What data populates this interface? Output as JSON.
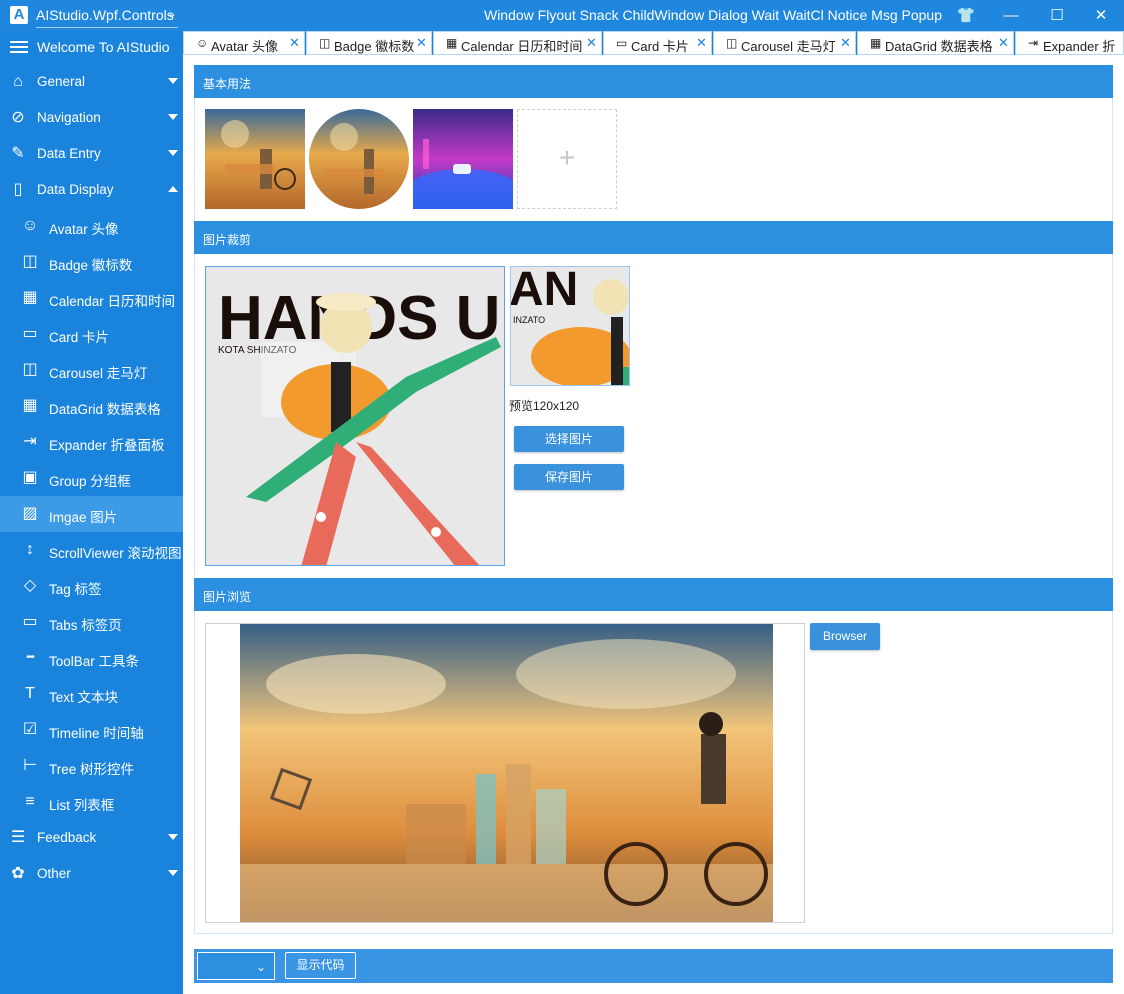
{
  "app": {
    "logo": "A",
    "title": "AIStudio.Wpf.Controls",
    "menu": "Window Flyout Snack ChildWindow Dialog Wait WaitCl Notice Msg Popup"
  },
  "window_buttons": {
    "theme": "👕",
    "minimize": "—",
    "maximize": "☐",
    "close": "✕"
  },
  "sidebar": {
    "header": "Welcome To AIStudio",
    "items": [
      {
        "label": "General",
        "icon": "⌂",
        "caret": "down"
      },
      {
        "label": "Navigation",
        "icon": "⊘",
        "caret": "down"
      },
      {
        "label": "Data Entry",
        "icon": "✎",
        "caret": "down"
      },
      {
        "label": "Data Display",
        "icon": "▯",
        "caret": "up"
      },
      {
        "label": "Avatar 头像",
        "icon": "☺"
      },
      {
        "label": "Badge 徽标数",
        "icon": "◫"
      },
      {
        "label": "Calendar 日历和时间",
        "icon": "▦"
      },
      {
        "label": "Card 卡片",
        "icon": "▭"
      },
      {
        "label": "Carousel 走马灯",
        "icon": "◫"
      },
      {
        "label": "DataGrid 数据表格",
        "icon": "▦"
      },
      {
        "label": "Expander 折叠面板",
        "icon": "⇥"
      },
      {
        "label": "Group 分组框",
        "icon": "▣"
      },
      {
        "label": "Imgae 图片",
        "icon": "▨",
        "active": true
      },
      {
        "label": "ScrollViewer 滚动视图",
        "icon": "↕"
      },
      {
        "label": "Tag 标签",
        "icon": "◇"
      },
      {
        "label": "Tabs 标签页",
        "icon": "▭"
      },
      {
        "label": "ToolBar 工具条",
        "icon": "•••"
      },
      {
        "label": "Text 文本块",
        "icon": "T"
      },
      {
        "label": "Timeline 时间轴",
        "icon": "☑"
      },
      {
        "label": "Tree 树形控件",
        "icon": "⊢"
      },
      {
        "label": "List 列表框",
        "icon": "≡"
      },
      {
        "label": "Feedback",
        "icon": "☰",
        "caret": "down"
      },
      {
        "label": "Other",
        "icon": "✿",
        "caret": "down"
      }
    ]
  },
  "tabs": [
    {
      "label": "Avatar 头像",
      "icon": "☺",
      "close": "✕"
    },
    {
      "label": "Badge 徽标数",
      "icon": "◫",
      "close": "✕"
    },
    {
      "label": "Calendar 日历和时间",
      "icon": "▦",
      "close": "✕"
    },
    {
      "label": "Card 卡片",
      "icon": "▭",
      "close": "✕"
    },
    {
      "label": "Carousel 走马灯",
      "icon": "◫",
      "close": "✕"
    },
    {
      "label": "DataGrid 数据表格",
      "icon": "▦",
      "close": "✕"
    },
    {
      "label": "Expander 折",
      "icon": "⇥",
      "close": ""
    }
  ],
  "sections": {
    "basic": {
      "title": "基本用法",
      "add_icon": "+"
    },
    "crop": {
      "title": "图片裁剪",
      "preview_label": "预览120x120",
      "select_button": "选择图片",
      "save_button": "保存图片",
      "artwork_text": "HANDS UP!",
      "artwork_subtext": "KOTA SHINZATO",
      "preview_text": "AN",
      "preview_subtext": "INZATO"
    },
    "browse": {
      "title": "图片浏览",
      "browser_button": "Browser"
    }
  },
  "bottom": {
    "combo_chevron": "⌄",
    "show_code_button": "显示代码"
  },
  "colors": {
    "primary": "#1a84dc",
    "section_header": "#2c8fe0",
    "button": "#3a92dd"
  }
}
